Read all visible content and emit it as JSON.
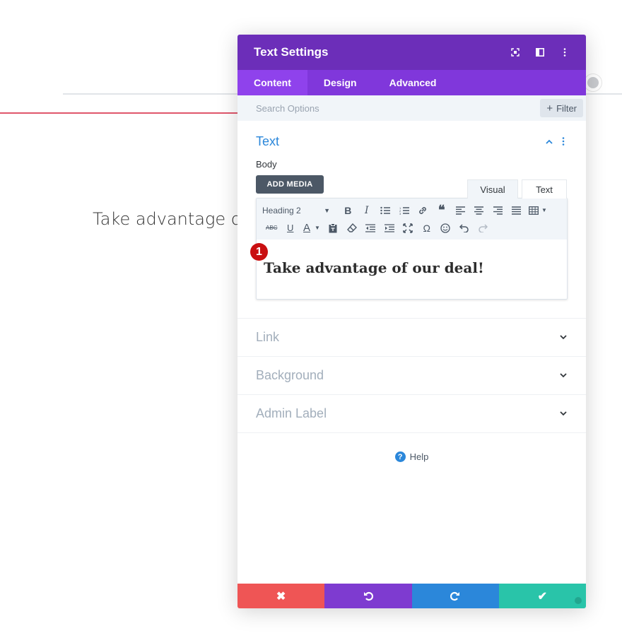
{
  "background": {
    "heading_text": "Take advantage of "
  },
  "modal": {
    "title": "Text Settings",
    "tabs": [
      {
        "label": "Content"
      },
      {
        "label": "Design"
      },
      {
        "label": "Advanced"
      }
    ],
    "search": {
      "placeholder": "Search Options"
    },
    "filter_label": "Filter",
    "text_section": {
      "title": "Text",
      "body_label": "Body",
      "add_media_label": "ADD MEDIA",
      "mode_visual": "Visual",
      "mode_text": "Text",
      "format_select": "Heading 2",
      "content": "Take advantage of our deal!"
    },
    "badge": "1",
    "sections": [
      {
        "title": "Link"
      },
      {
        "title": "Background"
      },
      {
        "title": "Admin Label"
      }
    ],
    "help_label": "Help"
  },
  "colors": {
    "header": "#6c2eb9",
    "tabs": "#8037db",
    "discard": "#ef5555",
    "undo": "#7e3bd0",
    "redo": "#2b87da",
    "save": "#29c4a9"
  },
  "icons": {
    "header": [
      "target-icon",
      "sidebar-layout-icon",
      "more-vertical-icon"
    ],
    "toolbar_row1": [
      "bold-icon",
      "italic-icon",
      "bullet-list-icon",
      "numbered-list-icon",
      "link-icon",
      "blockquote-icon",
      "align-left-icon",
      "align-center-icon",
      "align-right-icon",
      "align-justify-icon",
      "table-icon"
    ],
    "toolbar_row2": [
      "strikethrough-icon",
      "underline-icon",
      "text-color-icon",
      "paste-as-text-icon",
      "clear-formatting-icon",
      "outdent-icon",
      "indent-icon",
      "fullscreen-icon",
      "special-character-icon",
      "emoji-icon",
      "undo-icon",
      "redo-icon"
    ],
    "footer": [
      "close-icon",
      "undo-icon",
      "redo-icon",
      "check-icon"
    ]
  }
}
